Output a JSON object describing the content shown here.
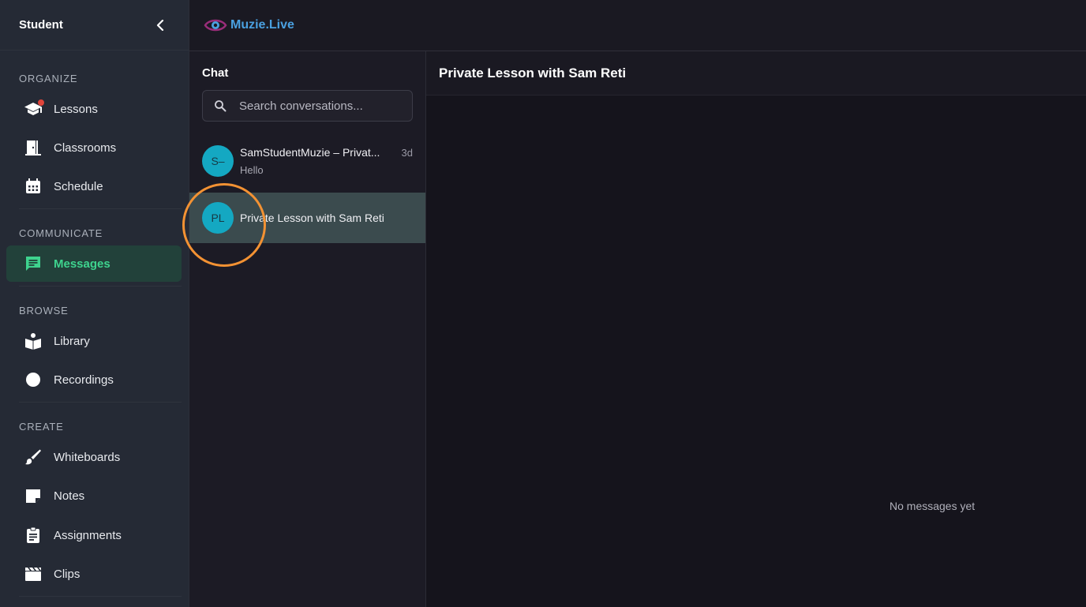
{
  "sidebar": {
    "title": "Student",
    "sections": {
      "organize": "ORGANIZE",
      "communicate": "COMMUNICATE",
      "browse": "BROWSE",
      "create": "CREATE"
    },
    "items": {
      "lessons": "Lessons",
      "classrooms": "Classrooms",
      "schedule": "Schedule",
      "messages": "Messages",
      "library": "Library",
      "recordings": "Recordings",
      "whiteboards": "Whiteboards",
      "notes": "Notes",
      "assignments": "Assignments",
      "clips": "Clips"
    },
    "active_item": "Messages"
  },
  "header": {
    "logo_text": "Muzie.Live"
  },
  "chat": {
    "title": "Chat",
    "search_placeholder": "Search conversations...",
    "conversations": [
      {
        "initials": "S–",
        "name": "SamStudentMuzie – Privat...",
        "time": "3d",
        "preview": "Hello"
      },
      {
        "initials": "PL",
        "name": "Private Lesson with Sam Reti",
        "time": "",
        "preview": ""
      }
    ]
  },
  "conversation": {
    "title": "Private Lesson with Sam Reti",
    "empty_text": "No messages yet"
  },
  "colors": {
    "accent": "#3ed38e",
    "avatar": "#14a8c2",
    "highlight_ring": "#f39233",
    "notification_dot": "#e0443a"
  }
}
